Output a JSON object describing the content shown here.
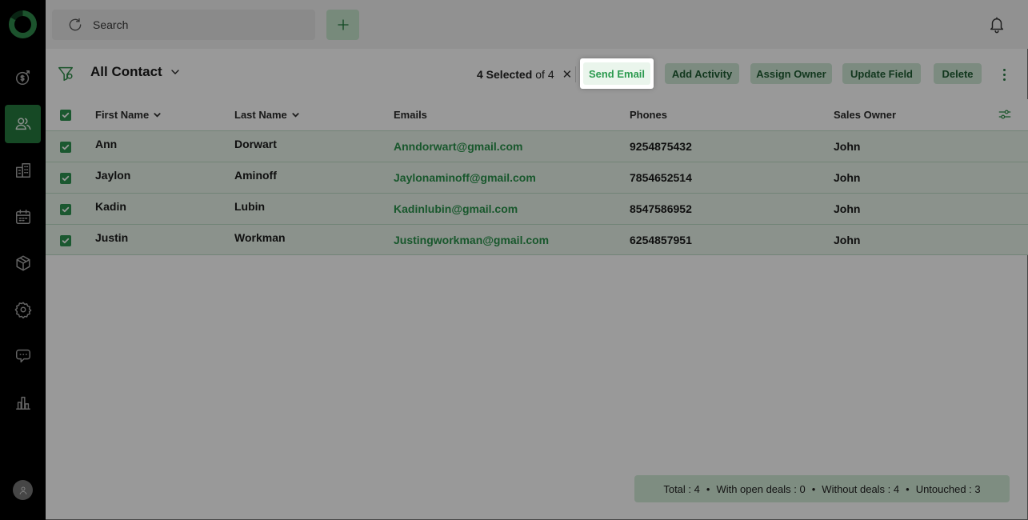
{
  "app": {
    "colors": {
      "accent": "#2e9350",
      "sidebar_bg": "#000000",
      "row_selected": "#e8f4ea",
      "button_bg": "#cfe8d5"
    }
  },
  "sidebar": {
    "items": [
      {
        "icon": "deals-icon",
        "active": false
      },
      {
        "icon": "contacts-icon",
        "active": true
      },
      {
        "icon": "companies-icon",
        "active": false
      },
      {
        "icon": "calendar-icon",
        "active": false
      },
      {
        "icon": "products-icon",
        "active": false
      },
      {
        "icon": "settings-icon",
        "active": false
      },
      {
        "icon": "chat-icon",
        "active": false
      },
      {
        "icon": "reports-icon",
        "active": false
      }
    ],
    "avatar_icon": "user-icon"
  },
  "topbar": {
    "search_placeholder": "Search",
    "add_icon": "plus-icon",
    "notification_icon": "bell-icon"
  },
  "toolbar": {
    "view_title": "All Contact",
    "selected_count": "4 Selected",
    "selected_total": "of 4",
    "clear_label": "✕",
    "send_email": "Send Email",
    "add_activity": "Add Activity",
    "assign_owner": "Assign Owner",
    "update_field": "Update Field",
    "delete": "Delete"
  },
  "table": {
    "columns": [
      "First Name",
      "Last Name",
      "Emails",
      "Phones",
      "Sales Owner"
    ],
    "rows": [
      {
        "first": "Ann",
        "last": "Dorwart",
        "email": "Anndorwart@gmail.com",
        "phone": "9254875432",
        "owner": "John",
        "checked": true
      },
      {
        "first": "Jaylon",
        "last": "Aminoff",
        "email": "Jaylonaminoff@gmail.com",
        "phone": "7854652514",
        "owner": "John",
        "checked": true
      },
      {
        "first": "Kadin",
        "last": "Lubin",
        "email": "Kadinlubin@gmail.com",
        "phone": "8547586952",
        "owner": "John",
        "checked": true
      },
      {
        "first": "Justin",
        "last": "Workman",
        "email": "Justingworkman@gmail.com",
        "phone": "6254857951",
        "owner": "John",
        "checked": true
      }
    ]
  },
  "footer": {
    "total": "Total : 4",
    "open_deals": "With open deals : 0",
    "without_deals": "Without deals : 4",
    "untouched": "Untouched : 3",
    "separator": "•"
  }
}
